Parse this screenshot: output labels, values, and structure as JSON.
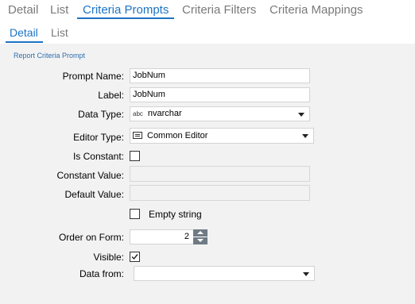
{
  "tabs": [
    "Detail",
    "List",
    "Criteria Prompts",
    "Criteria Filters",
    "Criteria Mappings"
  ],
  "subtabs": [
    "Detail",
    "List"
  ],
  "section_title": "Report Criteria Prompt",
  "form": {
    "prompt_name": {
      "label": "Prompt Name:",
      "value": "JobNum"
    },
    "label": {
      "label": "Label:",
      "value": "JobNum"
    },
    "data_type": {
      "label": "Data Type:",
      "icon_text": "abc",
      "value": "nvarchar"
    },
    "editor_type": {
      "label": "Editor Type:",
      "value": "Common Editor"
    },
    "is_constant": {
      "label": "Is Constant:",
      "checked": false
    },
    "constant_value": {
      "label": "Constant Value:",
      "value": ""
    },
    "default_value": {
      "label": "Default Value:",
      "value": ""
    },
    "empty_string": {
      "label": "Empty string",
      "checked": false
    },
    "order_on_form": {
      "label": "Order on Form:",
      "value": "2"
    },
    "visible": {
      "label": "Visible:",
      "checked": true
    },
    "data_from": {
      "label": "Data from:",
      "value": ""
    }
  },
  "colors": {
    "accent": "#1d73c4",
    "panel_bg": "#f2f2f2"
  }
}
